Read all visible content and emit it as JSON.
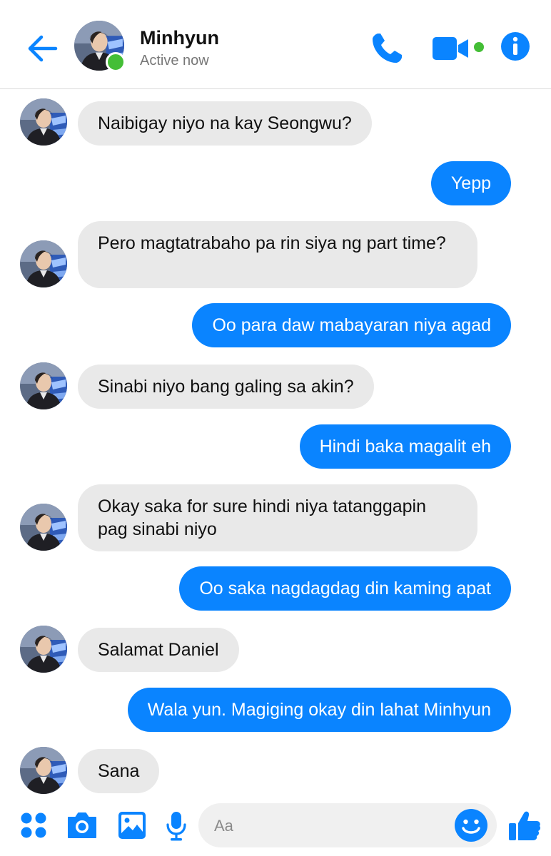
{
  "header": {
    "contact_name": "Minhyun",
    "status": "Active now"
  },
  "colors": {
    "accent": "#0a84ff",
    "online": "#44be36",
    "incoming_bubble": "#e9e9e9"
  },
  "messages": [
    {
      "from": "contact",
      "text": "Naibigay niyo na kay Seongwu?"
    },
    {
      "from": "me",
      "text": "Yepp"
    },
    {
      "from": "contact",
      "text": "Pero magtatrabaho pa rin siya ng part time?"
    },
    {
      "from": "me",
      "text": "Oo para daw mabayaran niya agad"
    },
    {
      "from": "contact",
      "text": "Sinabi niyo bang galing sa akin?"
    },
    {
      "from": "me",
      "text": "Hindi baka magalit eh"
    },
    {
      "from": "contact",
      "text": "Okay saka for sure hindi niya tatanggapin pag sinabi niyo"
    },
    {
      "from": "me",
      "text": "Oo saka nagdagdag din kaming apat"
    },
    {
      "from": "contact",
      "text": "Salamat Daniel"
    },
    {
      "from": "me",
      "text": "Wala yun. Magiging okay din lahat Minhyun"
    },
    {
      "from": "contact",
      "text": "Sana"
    }
  ],
  "composer": {
    "placeholder": "Aa",
    "icons": [
      "apps-icon",
      "camera-icon",
      "gallery-icon",
      "microphone-icon",
      "emoji-icon",
      "thumbs-up-icon"
    ]
  }
}
